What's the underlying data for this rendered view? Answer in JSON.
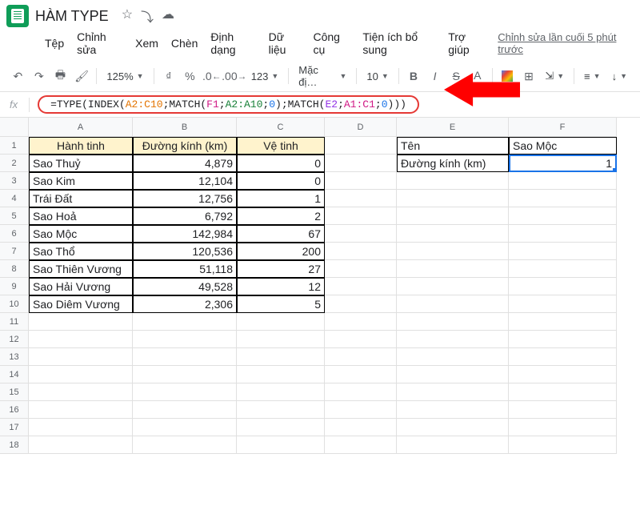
{
  "doc_title": "HÀM TYPE",
  "menu": [
    "Tệp",
    "Chỉnh sửa",
    "Xem",
    "Chèn",
    "Định dạng",
    "Dữ liệu",
    "Công cụ",
    "Tiện ích bổ sung",
    "Trợ giúp"
  ],
  "last_edit": "Chỉnh sửa lần cuối 5 phút trước",
  "toolbar": {
    "zoom": "125%",
    "currency": "₫",
    "percent": "%",
    "dec_dec": ".0̲",
    "dec_inc": ".00̲",
    "more_formats": "123",
    "font": "Mặc đị…",
    "font_size": "10",
    "bold": "B",
    "italic": "I",
    "strike": "S",
    "text_color": "A"
  },
  "formula": {
    "prefix": "=TYPE(INDEX(",
    "range1": "A2:C10",
    "mid1": ";MATCH(",
    "arg1": "F1",
    "mid2": ";",
    "range2": "A2:A10",
    "mid3": ";",
    "zero1": "0",
    "mid4": ");MATCH(",
    "arg2": "E2",
    "mid5": ";",
    "range3": "A1:C1",
    "mid6": ";",
    "zero2": "0",
    "suffix": ")))"
  },
  "fx_label": "fx",
  "columns": [
    "A",
    "B",
    "C",
    "D",
    "E",
    "F"
  ],
  "row_numbers": [
    1,
    2,
    3,
    4,
    5,
    6,
    7,
    8,
    9,
    10,
    11,
    12,
    13,
    14,
    15,
    16,
    17,
    18
  ],
  "table": {
    "headers": [
      "Hành tinh",
      "Đường kính (km)",
      "Vệ tinh"
    ],
    "rows": [
      [
        "Sao Thuỷ",
        "4,879",
        "0"
      ],
      [
        "Sao Kim",
        "12,104",
        "0"
      ],
      [
        "Trái Đất",
        "12,756",
        "1"
      ],
      [
        "Sao Hoả",
        "6,792",
        "2"
      ],
      [
        "Sao Mộc",
        "142,984",
        "67"
      ],
      [
        "Sao Thổ",
        "120,536",
        "200"
      ],
      [
        "Sao Thiên Vương",
        "51,118",
        "27"
      ],
      [
        "Sao Hải Vương",
        "49,528",
        "12"
      ],
      [
        "Sao Diêm Vương",
        "2,306",
        "5"
      ]
    ]
  },
  "lookup": {
    "e1": "Tên",
    "f1": "Sao Mộc",
    "e2": "Đường kính (km)",
    "f2": "1"
  },
  "chart_data": {
    "type": "table",
    "title": "HÀM TYPE example",
    "headers": [
      "Hành tinh",
      "Đường kính (km)",
      "Vệ tinh"
    ],
    "rows": [
      [
        "Sao Thuỷ",
        4879,
        0
      ],
      [
        "Sao Kim",
        12104,
        0
      ],
      [
        "Trái Đất",
        12756,
        1
      ],
      [
        "Sao Hoả",
        6792,
        2
      ],
      [
        "Sao Mộc",
        142984,
        67
      ],
      [
        "Sao Thổ",
        120536,
        200
      ],
      [
        "Sao Thiên Vương",
        51118,
        27
      ],
      [
        "Sao Hải Vương",
        49528,
        12
      ],
      [
        "Sao Diêm Vương",
        2306,
        5
      ]
    ]
  }
}
